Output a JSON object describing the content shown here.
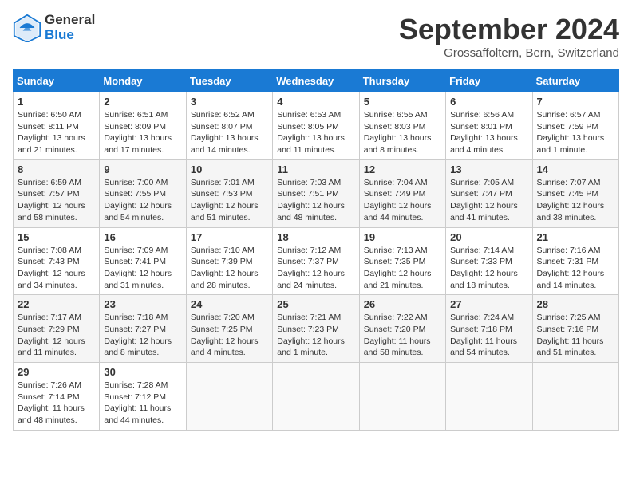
{
  "logo": {
    "general": "General",
    "blue": "Blue"
  },
  "title": "September 2024",
  "location": "Grossaffoltern, Bern, Switzerland",
  "headers": [
    "Sunday",
    "Monday",
    "Tuesday",
    "Wednesday",
    "Thursday",
    "Friday",
    "Saturday"
  ],
  "weeks": [
    [
      {
        "day": "1",
        "info": "Sunrise: 6:50 AM\nSunset: 8:11 PM\nDaylight: 13 hours\nand 21 minutes."
      },
      {
        "day": "2",
        "info": "Sunrise: 6:51 AM\nSunset: 8:09 PM\nDaylight: 13 hours\nand 17 minutes."
      },
      {
        "day": "3",
        "info": "Sunrise: 6:52 AM\nSunset: 8:07 PM\nDaylight: 13 hours\nand 14 minutes."
      },
      {
        "day": "4",
        "info": "Sunrise: 6:53 AM\nSunset: 8:05 PM\nDaylight: 13 hours\nand 11 minutes."
      },
      {
        "day": "5",
        "info": "Sunrise: 6:55 AM\nSunset: 8:03 PM\nDaylight: 13 hours\nand 8 minutes."
      },
      {
        "day": "6",
        "info": "Sunrise: 6:56 AM\nSunset: 8:01 PM\nDaylight: 13 hours\nand 4 minutes."
      },
      {
        "day": "7",
        "info": "Sunrise: 6:57 AM\nSunset: 7:59 PM\nDaylight: 13 hours\nand 1 minute."
      }
    ],
    [
      {
        "day": "8",
        "info": "Sunrise: 6:59 AM\nSunset: 7:57 PM\nDaylight: 12 hours\nand 58 minutes."
      },
      {
        "day": "9",
        "info": "Sunrise: 7:00 AM\nSunset: 7:55 PM\nDaylight: 12 hours\nand 54 minutes."
      },
      {
        "day": "10",
        "info": "Sunrise: 7:01 AM\nSunset: 7:53 PM\nDaylight: 12 hours\nand 51 minutes."
      },
      {
        "day": "11",
        "info": "Sunrise: 7:03 AM\nSunset: 7:51 PM\nDaylight: 12 hours\nand 48 minutes."
      },
      {
        "day": "12",
        "info": "Sunrise: 7:04 AM\nSunset: 7:49 PM\nDaylight: 12 hours\nand 44 minutes."
      },
      {
        "day": "13",
        "info": "Sunrise: 7:05 AM\nSunset: 7:47 PM\nDaylight: 12 hours\nand 41 minutes."
      },
      {
        "day": "14",
        "info": "Sunrise: 7:07 AM\nSunset: 7:45 PM\nDaylight: 12 hours\nand 38 minutes."
      }
    ],
    [
      {
        "day": "15",
        "info": "Sunrise: 7:08 AM\nSunset: 7:43 PM\nDaylight: 12 hours\nand 34 minutes."
      },
      {
        "day": "16",
        "info": "Sunrise: 7:09 AM\nSunset: 7:41 PM\nDaylight: 12 hours\nand 31 minutes."
      },
      {
        "day": "17",
        "info": "Sunrise: 7:10 AM\nSunset: 7:39 PM\nDaylight: 12 hours\nand 28 minutes."
      },
      {
        "day": "18",
        "info": "Sunrise: 7:12 AM\nSunset: 7:37 PM\nDaylight: 12 hours\nand 24 minutes."
      },
      {
        "day": "19",
        "info": "Sunrise: 7:13 AM\nSunset: 7:35 PM\nDaylight: 12 hours\nand 21 minutes."
      },
      {
        "day": "20",
        "info": "Sunrise: 7:14 AM\nSunset: 7:33 PM\nDaylight: 12 hours\nand 18 minutes."
      },
      {
        "day": "21",
        "info": "Sunrise: 7:16 AM\nSunset: 7:31 PM\nDaylight: 12 hours\nand 14 minutes."
      }
    ],
    [
      {
        "day": "22",
        "info": "Sunrise: 7:17 AM\nSunset: 7:29 PM\nDaylight: 12 hours\nand 11 minutes."
      },
      {
        "day": "23",
        "info": "Sunrise: 7:18 AM\nSunset: 7:27 PM\nDaylight: 12 hours\nand 8 minutes."
      },
      {
        "day": "24",
        "info": "Sunrise: 7:20 AM\nSunset: 7:25 PM\nDaylight: 12 hours\nand 4 minutes."
      },
      {
        "day": "25",
        "info": "Sunrise: 7:21 AM\nSunset: 7:23 PM\nDaylight: 12 hours\nand 1 minute."
      },
      {
        "day": "26",
        "info": "Sunrise: 7:22 AM\nSunset: 7:20 PM\nDaylight: 11 hours\nand 58 minutes."
      },
      {
        "day": "27",
        "info": "Sunrise: 7:24 AM\nSunset: 7:18 PM\nDaylight: 11 hours\nand 54 minutes."
      },
      {
        "day": "28",
        "info": "Sunrise: 7:25 AM\nSunset: 7:16 PM\nDaylight: 11 hours\nand 51 minutes."
      }
    ],
    [
      {
        "day": "29",
        "info": "Sunrise: 7:26 AM\nSunset: 7:14 PM\nDaylight: 11 hours\nand 48 minutes."
      },
      {
        "day": "30",
        "info": "Sunrise: 7:28 AM\nSunset: 7:12 PM\nDaylight: 11 hours\nand 44 minutes."
      },
      {
        "day": "",
        "info": ""
      },
      {
        "day": "",
        "info": ""
      },
      {
        "day": "",
        "info": ""
      },
      {
        "day": "",
        "info": ""
      },
      {
        "day": "",
        "info": ""
      }
    ]
  ]
}
